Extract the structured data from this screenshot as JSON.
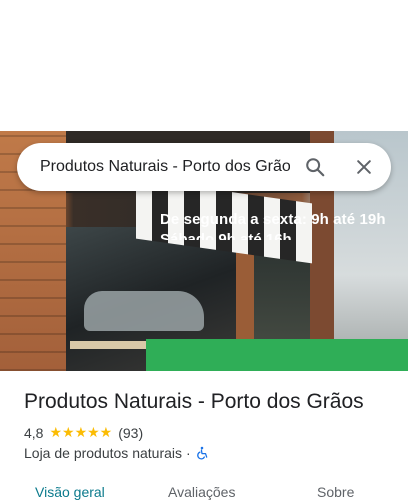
{
  "search": {
    "query": "Produtos Naturais - Porto dos Grãos",
    "search_icon": "search-icon",
    "close_icon": "close-icon"
  },
  "hero": {
    "banner_line1": "De segunda a sexta: 9h até 19h",
    "banner_line2": "Sábado 9h até 16h",
    "banner_color": "#2fae57"
  },
  "place": {
    "title": "Produtos Naturais - Porto dos Grãos",
    "rating": "4,8",
    "stars": "★★★★★",
    "stars_value": 4.8,
    "reviews": "(93)",
    "category": "Loja de produtos naturais",
    "separator": "·",
    "accessibility_icon": "wheelchair-icon"
  },
  "tabs": [
    {
      "label": "Visão geral",
      "active": true
    },
    {
      "label": "Avaliações",
      "active": false
    },
    {
      "label": "Sobre",
      "active": false
    }
  ],
  "colors": {
    "star": "#fbbc04",
    "active_tab": "#0b7a8c",
    "accessibility": "#1a73e8"
  }
}
